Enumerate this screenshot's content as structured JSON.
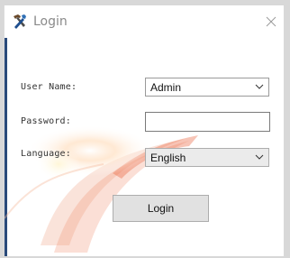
{
  "window": {
    "title": "Login"
  },
  "form": {
    "username": {
      "label": "User Name:",
      "value": "Admin"
    },
    "password": {
      "label": "Password:",
      "value": ""
    },
    "language": {
      "label": "Language:",
      "value": "English"
    },
    "login_label": "Login"
  },
  "icons": {
    "app": "tools-icon",
    "close": "close-icon",
    "dropdown": "chevron-down-icon"
  },
  "colors": {
    "title_text": "#8a8a8a",
    "button_bg": "#e1e1e1",
    "language_select_bg": "#ebebeb",
    "swirl_accent": "#e8552f"
  }
}
